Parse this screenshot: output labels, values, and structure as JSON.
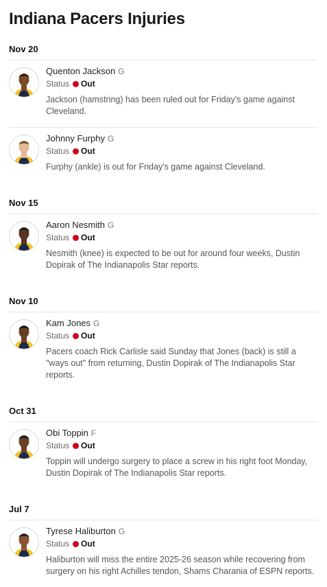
{
  "page": {
    "title": "Indiana Pacers Injuries"
  },
  "status_label": "Status",
  "groups": [
    {
      "date": "Nov 20",
      "entries": [
        {
          "name": "Quenton Jackson",
          "position": "G",
          "status": "Out",
          "skin": "#7a4a2c",
          "hair": "#2a1a10",
          "note": "Jackson (hamstring) has been ruled out for Friday's game against Cleveland."
        },
        {
          "name": "Johnny Furphy",
          "position": "G",
          "status": "Out",
          "skin": "#e4b795",
          "hair": "#6b4a2a",
          "note": "Furphy (ankle) is out for Friday's game against Cleveland."
        }
      ]
    },
    {
      "date": "Nov 15",
      "entries": [
        {
          "name": "Aaron Nesmith",
          "position": "G",
          "status": "Out",
          "skin": "#5a3420",
          "hair": "#1a1a1a",
          "note": "Nesmith (knee) is expected to be out for around four weeks, Dustin Dopirak of The Indianapolis Star reports."
        }
      ]
    },
    {
      "date": "Nov 10",
      "entries": [
        {
          "name": "Kam Jones",
          "position": "G",
          "status": "Out",
          "skin": "#6a3d24",
          "hair": "#1a1a1a",
          "note": "Pacers coach Rick Carlisle said Sunday that Jones (back) is still a \"ways out\" from returning, Dustin Dopirak of The Indianapolis Star reports."
        }
      ]
    },
    {
      "date": "Oct 31",
      "entries": [
        {
          "name": "Obi Toppin",
          "position": "F",
          "status": "Out",
          "skin": "#6b4028",
          "hair": "#1a1a1a",
          "note": "Toppin will undergo surgery to place a screw in his right foot Monday, Dustin Dopirak of The Indianapolis Star reports."
        }
      ]
    },
    {
      "date": "Jul 7",
      "entries": [
        {
          "name": "Tyrese Haliburton",
          "position": "G",
          "status": "Out",
          "skin": "#8a5534",
          "hair": "#1a1a1a",
          "note": "Haliburton will miss the entire 2025-26 season while recovering from surgery on his right Achilles tendon, Shams Charania of ESPN reports."
        }
      ]
    }
  ]
}
